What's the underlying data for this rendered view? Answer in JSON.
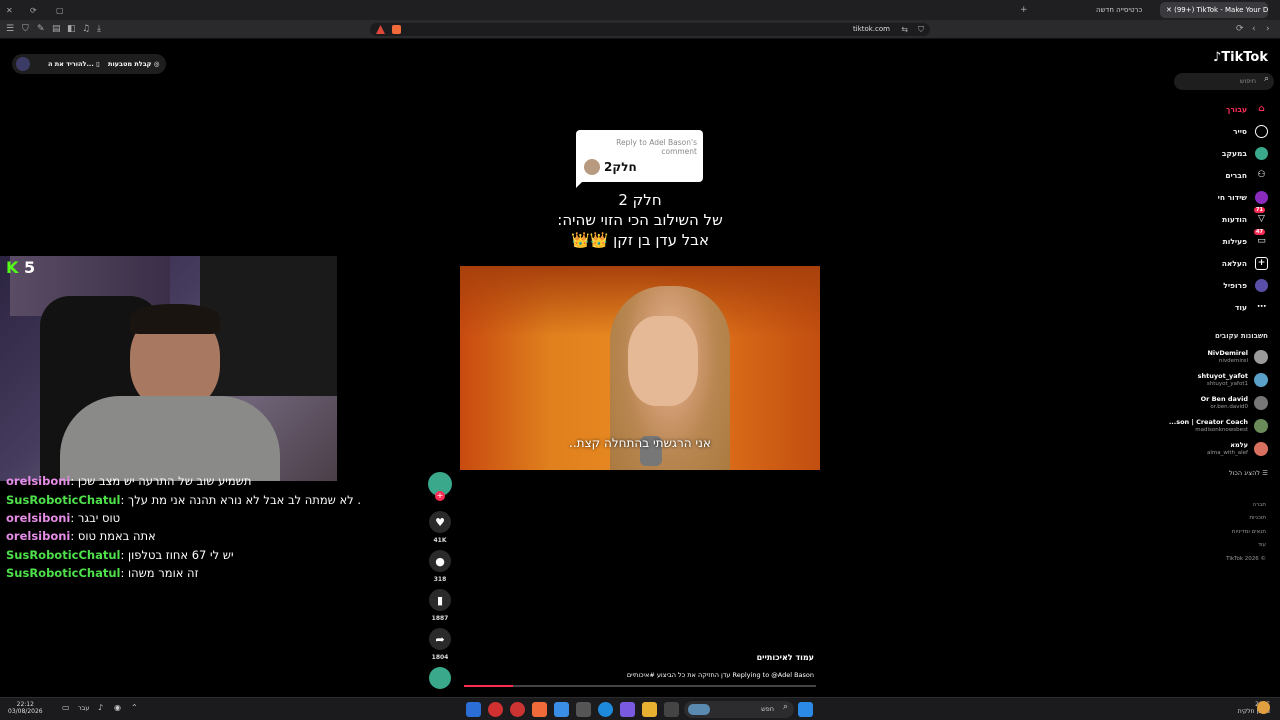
{
  "browser": {
    "tabs": [
      {
        "label": "(99+) TikTok - Make Your Day",
        "active": true
      },
      {
        "label": "כרטיסייה חדשה",
        "active": false
      }
    ],
    "url": "tikitok.com",
    "url_display": "tiktok.com"
  },
  "top_overlay": {
    "coins_label": "קבלת מטבעות",
    "download_label": "להוריד את ה..."
  },
  "sidebar": {
    "logo": "TikTok",
    "search_placeholder": "חיפוש",
    "nav": [
      {
        "label": "עבורך",
        "icon": "home-icon",
        "color": "#fe2c55"
      },
      {
        "label": "סייר",
        "icon": "compass-icon"
      },
      {
        "label": "במעקב",
        "icon": "following-icon"
      },
      {
        "label": "חברים",
        "icon": "friends-icon"
      },
      {
        "label": "שידור חי",
        "icon": "live-icon"
      },
      {
        "label": "הודעות",
        "icon": "messages-icon",
        "badge": "71"
      },
      {
        "label": "פעילות",
        "icon": "activity-icon",
        "badge": "47"
      },
      {
        "label": "העלאה",
        "icon": "upload-icon"
      },
      {
        "label": "פרופיל",
        "icon": "profile-icon"
      },
      {
        "label": "עוד",
        "icon": "more-icon"
      }
    ],
    "following_title": "חשבונות עקובים",
    "accounts": [
      {
        "name": "NivDemirel",
        "handle": "nivdemirel",
        "avatar_color": "#9a9a9a"
      },
      {
        "name": "shtuyot_yafot",
        "handle": "shtuyot_yafot1",
        "avatar_color": "#5aa0c8"
      },
      {
        "name": "Or Ben david",
        "handle": "or.ben.david0",
        "avatar_color": "#777777"
      },
      {
        "name": "...son | Creator Coach",
        "handle": "madisonknowsbest",
        "avatar_color": "#6a8a5a"
      },
      {
        "name": "עלמא",
        "handle": "alma_with_alef",
        "avatar_color": "#d87060"
      }
    ],
    "show_all": "להציג הכול",
    "footer": [
      "חברה",
      "תוכניות",
      "תנאים ומדיניות",
      "עוד"
    ],
    "copyright": "TikTok 2026 ©"
  },
  "video": {
    "reply_header": "Reply to Adel Bason's comment",
    "reply_text": "חלק2",
    "caption_lines": [
      "חלק 2",
      "של השילוב הכי הזוי שהיה:",
      "אבל עדן בן זקן 👑👑"
    ],
    "subtitle": "אני הרגשתי בהתחלה קצת..",
    "author": "עמוד לאיכותיים",
    "description": "Replying to @Adel Bason  עדן החזיקה את כל הביצוע #איכותיים",
    "progress_percent": 14
  },
  "actions": {
    "likes": "41K",
    "comments": "318",
    "saves": "1887",
    "shares": "1804"
  },
  "stream": {
    "kick_count": "5",
    "chat": [
      {
        "user": "orelsiboni",
        "msg": "תשמיע שוב של התרעה יש מצב שכן",
        "color": "#e58ce6"
      },
      {
        "user": "SusRoboticChatul",
        "msg": "לא שמתה לב אבל לא נורא תהנה אני מת עלך .",
        "color": "#4ee04a"
      },
      {
        "user": "orelsiboni",
        "msg": "טוס יבגר",
        "color": "#e58ce6"
      },
      {
        "user": "orelsiboni",
        "msg": "אתה באמת טוס",
        "color": "#e58ce6"
      },
      {
        "user": "SusRoboticChatul",
        "msg": "יש לי 67 אחוז בטלפון",
        "color": "#4ee04a"
      },
      {
        "user": "SusRoboticChatul",
        "msg": "זה אומר משהו",
        "color": "#4ee04a"
      }
    ]
  },
  "taskbar": {
    "time": "22:12",
    "date": "03/08/2026",
    "lang": "עבר",
    "search_label": "חפש",
    "weather_temp": "29°C",
    "weather_desc": "מעונן חלקית"
  }
}
